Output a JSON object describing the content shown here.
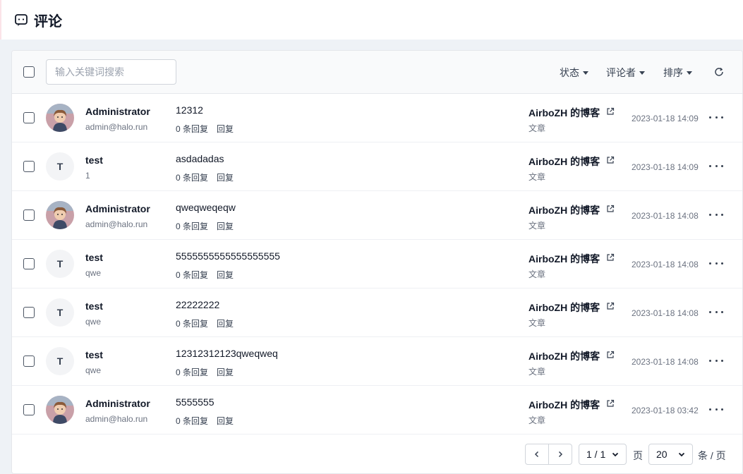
{
  "header": {
    "title": "评论",
    "icon": "comment-icon"
  },
  "toolbar": {
    "search_placeholder": "输入关键词搜索",
    "search_value": "",
    "filters": [
      {
        "label": "状态"
      },
      {
        "label": "评论者"
      },
      {
        "label": "排序"
      }
    ],
    "refresh_icon": "refresh-icon"
  },
  "comments": [
    {
      "avatar_type": "image",
      "avatar_letter": "",
      "author": "Administrator",
      "email": "admin@halo.run",
      "content": "12312",
      "reply_count": "0 条回复",
      "reply_label": "回复",
      "post_title": "AirboZH 的博客",
      "post_type": "文章",
      "time": "2023-01-18 14:09"
    },
    {
      "avatar_type": "letter",
      "avatar_letter": "T",
      "author": "test",
      "email": "1",
      "content": "asdadadas",
      "reply_count": "0 条回复",
      "reply_label": "回复",
      "post_title": "AirboZH 的博客",
      "post_type": "文章",
      "time": "2023-01-18 14:09"
    },
    {
      "avatar_type": "image",
      "avatar_letter": "",
      "author": "Administrator",
      "email": "admin@halo.run",
      "content": "qweqweqeqw",
      "reply_count": "0 条回复",
      "reply_label": "回复",
      "post_title": "AirboZH 的博客",
      "post_type": "文章",
      "time": "2023-01-18 14:08"
    },
    {
      "avatar_type": "letter",
      "avatar_letter": "T",
      "author": "test",
      "email": "qwe",
      "content": "5555555555555555555",
      "reply_count": "0 条回复",
      "reply_label": "回复",
      "post_title": "AirboZH 的博客",
      "post_type": "文章",
      "time": "2023-01-18 14:08"
    },
    {
      "avatar_type": "letter",
      "avatar_letter": "T",
      "author": "test",
      "email": "qwe",
      "content": "22222222",
      "reply_count": "0 条回复",
      "reply_label": "回复",
      "post_title": "AirboZH 的博客",
      "post_type": "文章",
      "time": "2023-01-18 14:08"
    },
    {
      "avatar_type": "letter",
      "avatar_letter": "T",
      "author": "test",
      "email": "qwe",
      "content": "12312312123qweqweq",
      "reply_count": "0 条回复",
      "reply_label": "回复",
      "post_title": "AirboZH 的博客",
      "post_type": "文章",
      "time": "2023-01-18 14:08"
    },
    {
      "avatar_type": "image",
      "avatar_letter": "",
      "author": "Administrator",
      "email": "admin@halo.run",
      "content": "5555555",
      "reply_count": "0 条回复",
      "reply_label": "回复",
      "post_title": "AirboZH 的博客",
      "post_type": "文章",
      "time": "2023-01-18 03:42"
    }
  ],
  "pagination": {
    "page_select": "1 / 1",
    "page_unit": "页",
    "page_size": "20",
    "size_unit": "条 / 页"
  }
}
